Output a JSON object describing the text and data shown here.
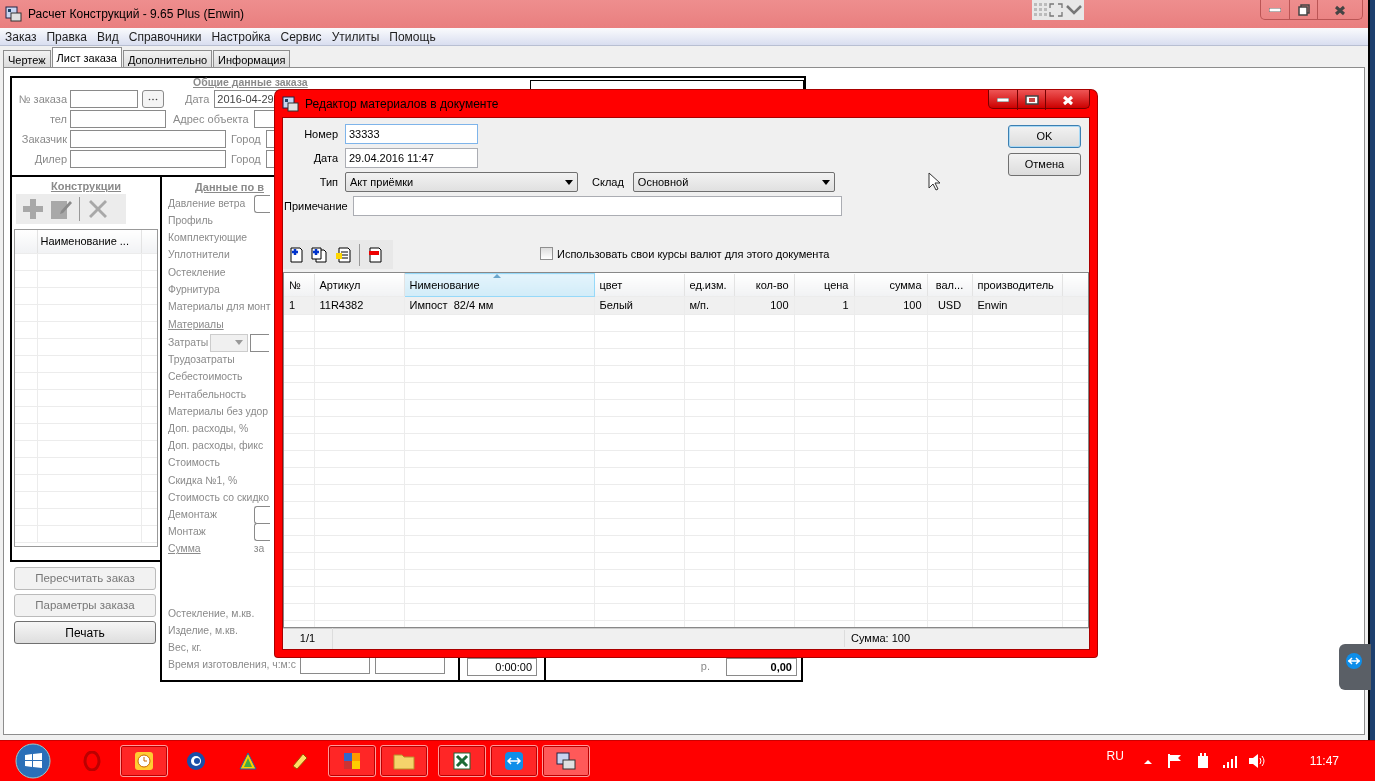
{
  "window": {
    "title": "Расчет Конструкций - 9.65 Plus (Enwin)"
  },
  "menu": [
    "Заказ",
    "Правка",
    "Вид",
    "Справочники",
    "Настройка",
    "Сервис",
    "Утилиты",
    "Помощь"
  ],
  "tabs": [
    {
      "label": "Чертеж",
      "selected": false
    },
    {
      "label": "Лист заказа",
      "selected": true
    },
    {
      "label": "Дополнительно",
      "selected": false
    },
    {
      "label": "Информация",
      "selected": false
    }
  ],
  "order_header": {
    "title": "Общие данные заказа",
    "left_fields": [
      {
        "label": "№ заказа",
        "kind": "lookup"
      },
      {
        "label": "тел",
        "kind": "field"
      },
      {
        "label": "Заказчик",
        "kind": "wide"
      },
      {
        "label": "Дилер",
        "kind": "wide"
      }
    ],
    "right_fields": [
      {
        "label": "Дата",
        "value": "2016-04-29"
      },
      {
        "label": "Адрес объекта"
      },
      {
        "label": "Город"
      },
      {
        "label": "Город"
      }
    ]
  },
  "constructions": {
    "title": "Конструкции",
    "column": "Наименование ...",
    "buttons": [
      {
        "label": "Пересчитать заказ",
        "disabled": true
      },
      {
        "label": "Параметры заказа",
        "disabled": true
      },
      {
        "label": "Печать",
        "disabled": false
      }
    ]
  },
  "details": {
    "title": "Данные по в",
    "rows": [
      {
        "label": "Давление ветра",
        "kind": "field"
      },
      {
        "label": "Профиль",
        "kind": "text"
      },
      {
        "label": "Комплектующие",
        "kind": "text"
      },
      {
        "label": "Уплотнители",
        "kind": "text"
      },
      {
        "label": "Остекление",
        "kind": "text"
      },
      {
        "label": "Фурнитура",
        "kind": "text"
      },
      {
        "label": "Материалы для монт",
        "kind": "text"
      },
      {
        "label": "Материалы",
        "kind": "link"
      },
      {
        "label": "Затраты",
        "kind": "select"
      },
      {
        "label": "Трудозатраты",
        "kind": "text"
      },
      {
        "label": "Себестоимость",
        "kind": "text"
      },
      {
        "label": "Рентабельность",
        "kind": "text"
      },
      {
        "label": "Материалы без удор",
        "kind": "text"
      },
      {
        "label": "Доп. расходы, %",
        "kind": "text"
      },
      {
        "label": "Доп. расходы, фикс",
        "kind": "text"
      },
      {
        "label": "Стоимость",
        "kind": "text"
      },
      {
        "label": "Скидка №1, %",
        "kind": "text"
      },
      {
        "label": "Стоимость со скидко",
        "kind": "text"
      },
      {
        "label": "Демонтаж",
        "kind": "field"
      },
      {
        "label": "Монтаж",
        "kind": "field"
      },
      {
        "label": "Сумма",
        "kind": "link",
        "note": "за"
      }
    ],
    "bottom_rows": [
      {
        "label": "Остекление, м.кв."
      },
      {
        "label": "Изделие, м.кв."
      },
      {
        "label": "Вес, кг."
      },
      {
        "label": "Время изготовления, ч:м:с",
        "kind": "fields"
      }
    ]
  },
  "totals": {
    "time": "0:00:00",
    "currency": "р.",
    "amount": "0,00"
  },
  "dialog": {
    "title": "Редактор материалов в документе",
    "number_label": "Номер",
    "number": "33333",
    "date_label": "Дата",
    "date": "29.04.2016 11:47",
    "type_label": "Тип",
    "type": "Акт приёмки",
    "warehouse_label": "Склад",
    "warehouse": "Основной",
    "note_label": "Примечание",
    "ok": "OK",
    "cancel": "Отмена",
    "own_rates": {
      "label": "Использовать свои курсы валют для этого документа",
      "checked": false
    },
    "table": {
      "columns": [
        {
          "label": "№",
          "sorted": false
        },
        {
          "label": "Артикул",
          "sorted": false
        },
        {
          "label": "Нименование",
          "sorted": true
        },
        {
          "label": "цвет",
          "sorted": false
        },
        {
          "label": "ед.изм.",
          "sorted": false
        },
        {
          "label": "кол-во",
          "sorted": false
        },
        {
          "label": "цена",
          "sorted": false
        },
        {
          "label": "сумма",
          "sorted": false
        },
        {
          "label": "вал...",
          "sorted": false
        },
        {
          "label": "производитель",
          "sorted": false
        }
      ],
      "rows": [
        {
          "cells": [
            "1",
            "11R4382",
            "Импост  82/4 мм",
            "Белый",
            "м/п.",
            "100",
            "1",
            "100",
            "USD",
            "Enwin"
          ],
          "selected": true
        }
      ]
    },
    "status": {
      "page": "1/1",
      "total": "Сумма: 100"
    }
  },
  "taskbar": {
    "language": "RU",
    "time": "11:47"
  }
}
